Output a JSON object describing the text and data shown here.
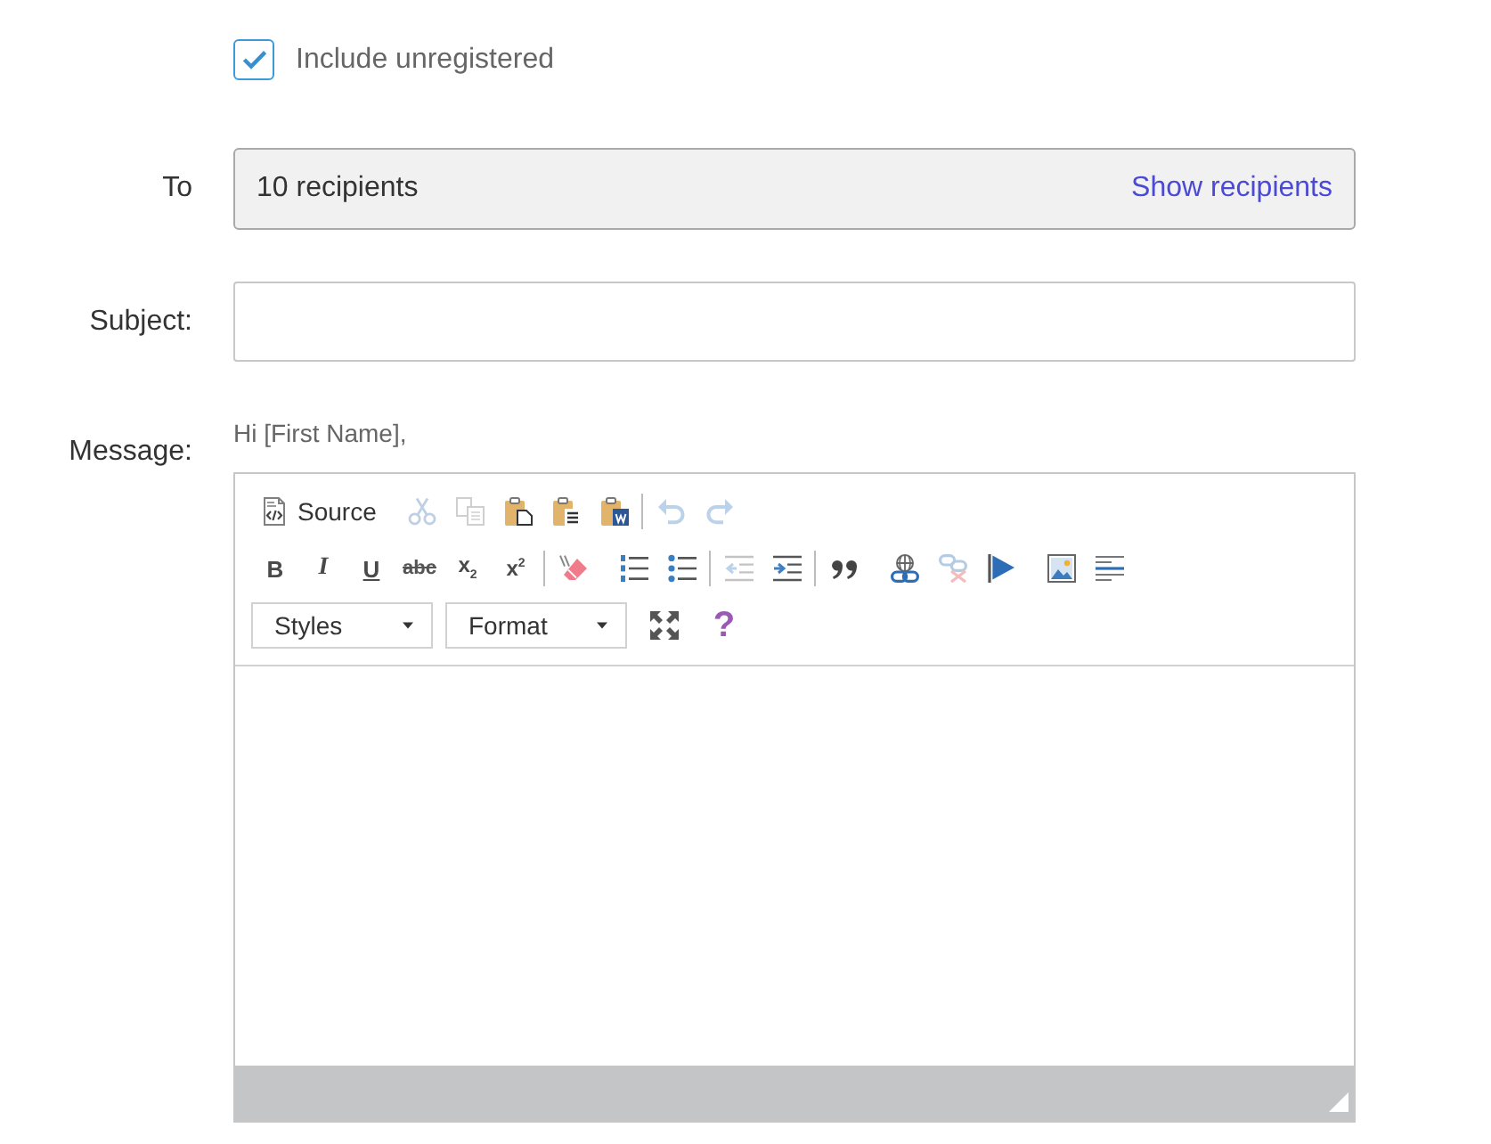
{
  "include_unregistered": {
    "label": "Include unregistered",
    "checked": true
  },
  "to": {
    "label": "To",
    "value": "10 recipients",
    "link": "Show recipients"
  },
  "subject": {
    "label": "Subject:"
  },
  "message": {
    "label": "Message:",
    "greeting": "Hi [First Name],",
    "editor": {
      "toolbar": [
        {
          "groups": [
            {
              "sets": [
                [
                  {
                    "kind": "source",
                    "label": "Source",
                    "disabled": false
                  }
                ]
              ]
            },
            {
              "sets": [
                [
                  {
                    "kind": "cut",
                    "disabled": true
                  },
                  {
                    "kind": "copy",
                    "disabled": true
                  },
                  {
                    "kind": "paste",
                    "disabled": false
                  },
                  {
                    "kind": "paste-text",
                    "disabled": false
                  },
                  {
                    "kind": "paste-word",
                    "disabled": false
                  }
                ],
                [
                  {
                    "kind": "undo",
                    "disabled": true
                  },
                  {
                    "kind": "redo",
                    "disabled": true
                  }
                ]
              ]
            }
          ]
        },
        {
          "groups": [
            {
              "sets": [
                [
                  {
                    "kind": "bold",
                    "text": "B",
                    "disabled": false
                  },
                  {
                    "kind": "italic",
                    "text": "I",
                    "disabled": false
                  },
                  {
                    "kind": "underline",
                    "text": "U",
                    "disabled": false
                  },
                  {
                    "kind": "strike",
                    "text": "abc",
                    "disabled": false
                  },
                  {
                    "kind": "subscript",
                    "text": "x$_{2}$",
                    "disabled": false
                  },
                  {
                    "kind": "superscript",
                    "text": "x$^{2}$",
                    "disabled": false
                  }
                ],
                [
                  {
                    "kind": "remove-format",
                    "disabled": false
                  }
                ]
              ]
            },
            {
              "sets": [
                [
                  {
                    "kind": "numbered-list",
                    "disabled": false
                  },
                  {
                    "kind": "bulleted-list",
                    "disabled": false
                  }
                ],
                [
                  {
                    "kind": "outdent",
                    "disabled": true
                  },
                  {
                    "kind": "indent",
                    "disabled": false
                  }
                ],
                [
                  {
                    "kind": "blockquote",
                    "disabled": false
                  }
                ]
              ]
            },
            {
              "sets": [
                [
                  {
                    "kind": "link",
                    "disabled": false
                  },
                  {
                    "kind": "unlink",
                    "disabled": true
                  },
                  {
                    "kind": "anchor",
                    "disabled": false
                  }
                ]
              ]
            },
            {
              "sets": [
                [
                  {
                    "kind": "image",
                    "disabled": false
                  },
                  {
                    "kind": "horizontal-line",
                    "disabled": false
                  }
                ]
              ]
            }
          ]
        },
        {
          "groups": [
            {
              "sets": [
                [
                  {
                    "kind": "combo",
                    "label": "Styles",
                    "disabled": false
                  }
                ]
              ]
            },
            {
              "sets": [
                [
                  {
                    "kind": "combo",
                    "label": "Format",
                    "disabled": false
                  }
                ]
              ]
            },
            {
              "sets": [
                [
                  {
                    "kind": "maximize",
                    "disabled": false
                  }
                ]
              ]
            },
            {
              "sets": [
                [
                  {
                    "kind": "help",
                    "text": "?",
                    "disabled": false
                  }
                ]
              ]
            }
          ]
        }
      ]
    }
  }
}
